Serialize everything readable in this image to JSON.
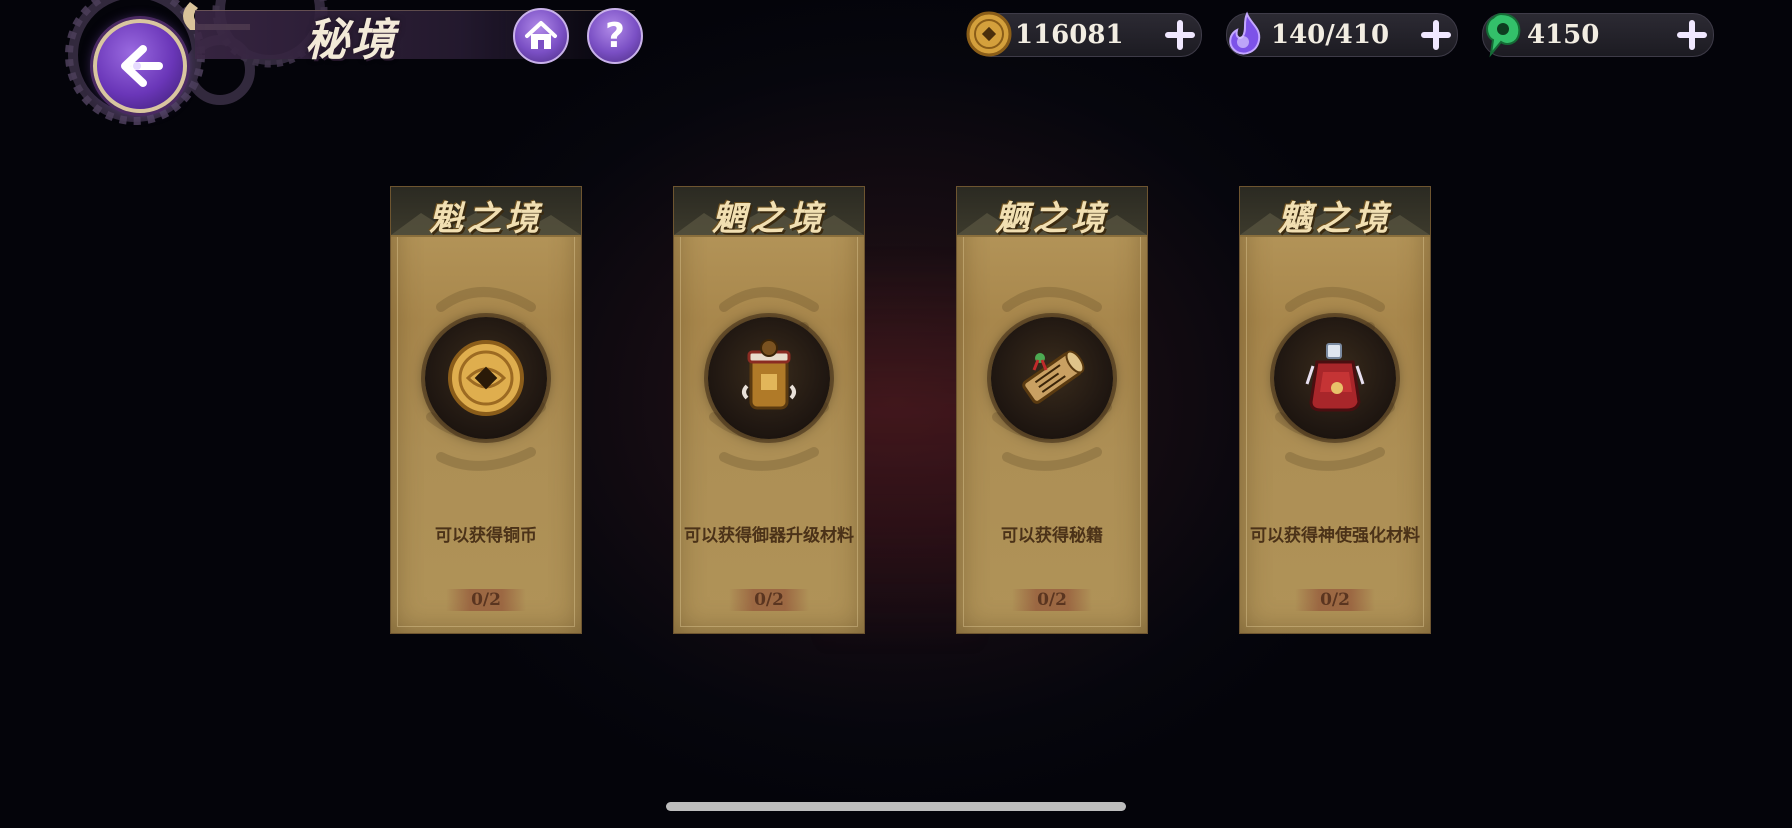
{
  "header": {
    "title": "秘境",
    "back_icon": "back-arrow-icon",
    "home_icon": "home-icon",
    "help_icon": "question-icon",
    "help_label": "?"
  },
  "resources": [
    {
      "name": "copper-coin",
      "value": "116081",
      "icon": "copper-coin-icon",
      "color": "#d9a642"
    },
    {
      "name": "stamina",
      "value": "140/410",
      "icon": "purple-flame-icon",
      "color": "#8a5cf0"
    },
    {
      "name": "jade",
      "value": "4150",
      "icon": "green-jade-icon",
      "color": "#35c46a"
    }
  ],
  "cards": [
    {
      "title": "魁之境",
      "reward": "可以获得铜币",
      "progress": "0/2",
      "item_icon": "copper-coin-icon"
    },
    {
      "title": "魍之境",
      "reward": "可以获得御器升级材料",
      "progress": "0/2",
      "item_icon": "treasure-jar-icon"
    },
    {
      "title": "魉之境",
      "reward": "可以获得秘籍",
      "progress": "0/2",
      "item_icon": "scroll-icon"
    },
    {
      "title": "魑之境",
      "reward": "可以获得神使强化材料",
      "progress": "0/2",
      "item_icon": "elixir-bottle-icon"
    }
  ]
}
